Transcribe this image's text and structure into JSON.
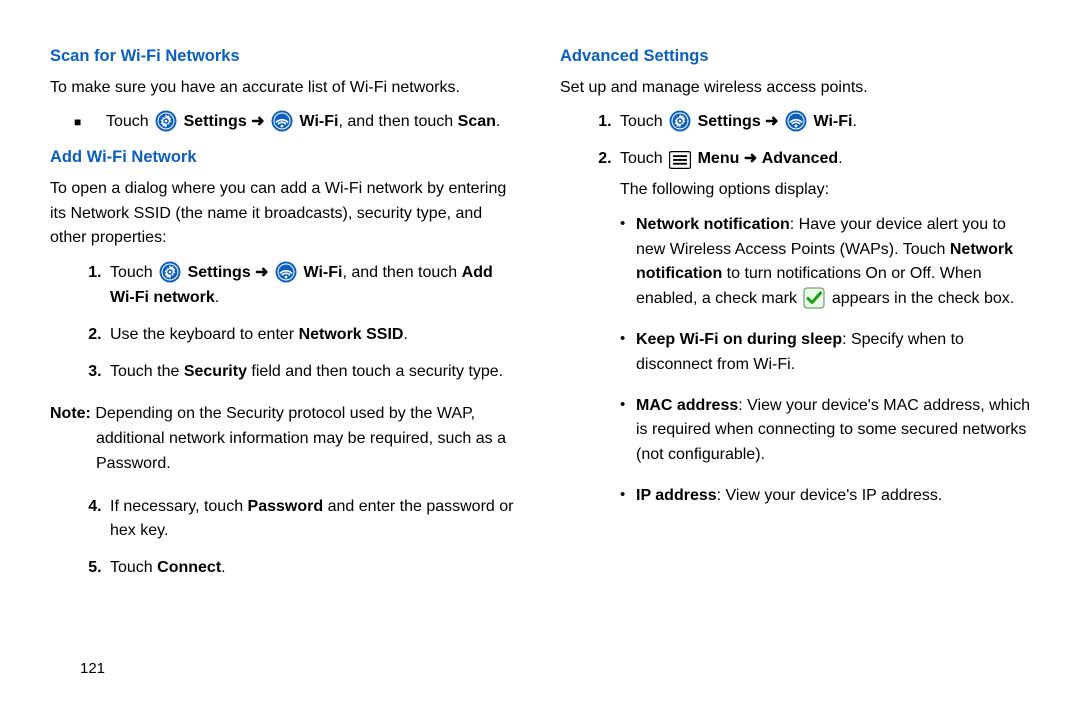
{
  "page_number": "121",
  "left": {
    "scan_heading": "Scan for Wi-Fi Networks",
    "scan_intro": "To make sure you have an accurate list of Wi-Fi networks.",
    "scan_bullet_pre": "Touch ",
    "scan_bullet_settings": "Settings",
    "scan_bullet_arrow": " ➜ ",
    "scan_bullet_wifi": "Wi-Fi",
    "scan_bullet_mid": ", and then touch ",
    "scan_bullet_scan": "Scan",
    "scan_bullet_post": ".",
    "add_heading": "Add Wi-Fi Network",
    "add_intro": "To open a dialog where you can add a Wi-Fi network by entering its Network SSID (the name it broadcasts), security type, and other properties:",
    "step1_pre": "Touch ",
    "step1_settings": "Settings",
    "step1_arrow": " ➜ ",
    "step1_wifi": "Wi-Fi",
    "step1_mid": ", and then touch ",
    "step1_add": "Add Wi-Fi network",
    "step1_post": ".",
    "step2_pre": "Use the keyboard to enter ",
    "step2_b": "Network SSID",
    "step2_post": ".",
    "step3_pre": "Touch the ",
    "step3_b": "Security",
    "step3_post": " field and then touch a security type.",
    "note_label": "Note:",
    "note_body": " Depending on the Security protocol used by the WAP, additional network information may be required, such as a Password.",
    "step4_pre": "If necessary, touch ",
    "step4_b": "Password",
    "step4_post": " and enter the password or hex key.",
    "step5_pre": "Touch ",
    "step5_b": "Connect",
    "step5_post": "."
  },
  "right": {
    "adv_heading": "Advanced Settings",
    "adv_intro": "Set up and manage wireless access points.",
    "r1_pre": "Touch ",
    "r1_settings": "Settings",
    "r1_arrow": " ➜ ",
    "r1_wifi": "Wi-Fi",
    "r1_post": ".",
    "r2_pre": "Touch ",
    "r2_menu": "Menu",
    "r2_arrow": " ➜ ",
    "r2_adv": "Advanced",
    "r2_post": ".",
    "r_follow": "The following options display:",
    "b1_t": "Network notification",
    "b1_a": ": Have your device alert you to new Wireless Access Points (WAPs). Touch ",
    "b1_b": "Network notification",
    "b1_c": " to turn notifications On or Off. When enabled, a check mark ",
    "b1_d": " appears in the check box.",
    "b2_t": "Keep Wi-Fi on during sleep",
    "b2_a": ": Specify when to disconnect from Wi-Fi.",
    "b3_t": "MAC address",
    "b3_a": ": View your device's MAC address, which is required when connecting to some secured networks (not configurable).",
    "b4_t": "IP address",
    "b4_a": ": View your device's IP address."
  },
  "icons": {
    "settings": "settings-gear-icon",
    "wifi": "wifi-icon",
    "menu": "menu-icon",
    "check": "check-icon"
  }
}
